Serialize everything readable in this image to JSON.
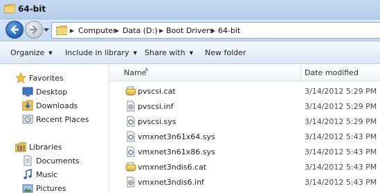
{
  "window": {
    "title": "64-bit"
  },
  "address": {
    "crumbs": [
      "Computer",
      "Data (D:)",
      "Boot Drivers",
      "64-bit"
    ],
    "separator": "▶"
  },
  "toolbar": {
    "organize": "Organize",
    "include_in_library": "Include in library",
    "share_with": "Share with",
    "new_folder": "New folder",
    "caret": "▼"
  },
  "nav": {
    "favorites": "Favorites",
    "desktop": "Desktop",
    "downloads": "Downloads",
    "recent_places": "Recent Places",
    "libraries": "Libraries",
    "documents": "Documents",
    "music": "Music",
    "pictures": "Pictures"
  },
  "files": {
    "columns": {
      "name": "Name",
      "date_modified": "Date modified",
      "sort_indicator": "▲"
    },
    "rows": [
      {
        "name": "pvscsi.cat",
        "date": "3/14/2012 5:29 PM",
        "type_icon": "catalog-icon"
      },
      {
        "name": "pvscsi.inf",
        "date": "3/14/2012 5:29 PM",
        "type_icon": "setup-info-icon"
      },
      {
        "name": "pvscsi.sys",
        "date": "3/14/2012 5:29 PM",
        "type_icon": "system-file-icon"
      },
      {
        "name": "vmxnet3n61x64.sys",
        "date": "3/14/2012 5:43 PM",
        "type_icon": "system-file-icon"
      },
      {
        "name": "vmxnet3n61x86.sys",
        "date": "3/14/2012 5:43 PM",
        "type_icon": "system-file-icon"
      },
      {
        "name": "vmxnet3ndis6.cat",
        "date": "3/14/2012 5:43 PM",
        "type_icon": "catalog-icon"
      },
      {
        "name": "vmxnet3ndis6.inf",
        "date": "3/14/2012 5:43 PM",
        "type_icon": "setup-info-icon"
      }
    ]
  },
  "colors": {
    "accent": "#1f5fb3",
    "titlebar": "#c6dbf2",
    "toolbar": "#dce8f5"
  }
}
